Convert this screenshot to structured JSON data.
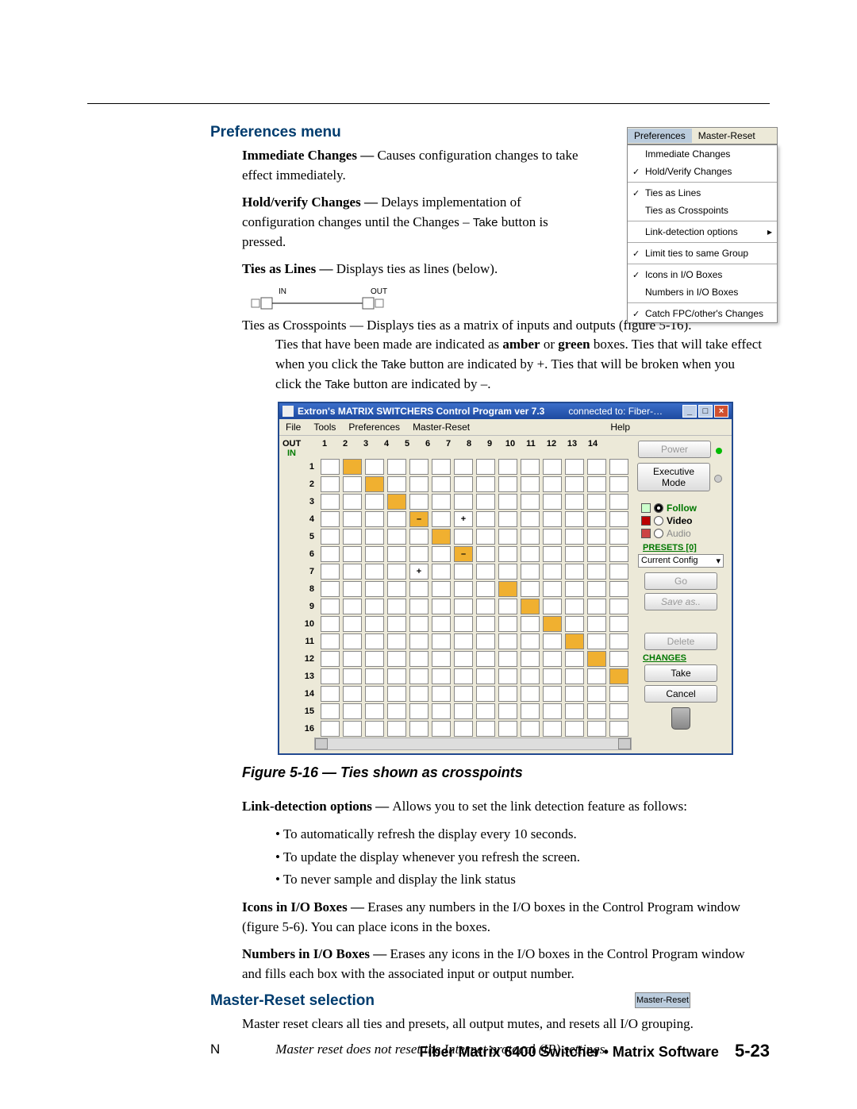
{
  "headings": {
    "prefs": "Preferences menu",
    "master": "Master-Reset selection"
  },
  "pref_menu": {
    "header": [
      "Preferences",
      "Master-Reset"
    ],
    "items": [
      "Immediate Changes",
      "Hold/Verify Changes",
      "Ties as Lines",
      "Ties as Crosspoints",
      "Link-detection options",
      "Limit ties to same Group",
      "Icons in I/O Boxes",
      "Numbers in I/O Boxes",
      "Catch FPC/other's Changes"
    ]
  },
  "io_diag": {
    "in": "IN",
    "out": "OUT"
  },
  "body": {
    "p1": {
      "b": "Immediate Changes — ",
      "t": "Causes configuration changes to take effect immediately."
    },
    "p2": {
      "b": "Hold/verify Changes — ",
      "t1": "Delays implementation of configuration changes until the Changes – ",
      "gui": "Take",
      "t2": " button is pressed."
    },
    "p3": {
      "b": "Ties as Lines — ",
      "t": "Displays ties as lines (below)."
    },
    "p4": {
      "t1": "Ties as Crosspoints — Displays ties as a matrix of inputs and outputs (figure 5-16).",
      "t2a": "Ties that have been made are indicated as ",
      "b1": "amber",
      "t2b": " or ",
      "b2": "green",
      "t2c": " boxes.  Ties that will take effect when you click the ",
      "gui1": "Take",
      "t3": " button are indicated by +.  Ties that will be broken when you click the ",
      "gui2": "Take",
      "t4": " button are indicated by –."
    },
    "p5": {
      "b": "Link-detection options — ",
      "t": "Allows you to set the link detection feature as follows:"
    },
    "bullets": [
      "To automatically refresh the display every 10 seconds.",
      "To update the display whenever you refresh the screen.",
      "To never sample and display the link status"
    ],
    "p6": {
      "b": "Icons in I/O Boxes — ",
      "t": "Erases any numbers in the I/O boxes in the Control Program window (figure 5-6).  You can place icons in the boxes."
    },
    "p7": {
      "b": "Numbers in I/O Boxes — ",
      "t": "Erases any icons in the I/O boxes in the Control Program window and fills each box with the associated input or output number."
    },
    "p8": "Master reset clears all ties and presets, all output mutes, and resets all I/O grouping."
  },
  "fig": {
    "title": "Extron's MATRIX SWITCHERS Control Program     ver 7.3",
    "connected": "connected to:  Fiber-…",
    "menus": [
      "File",
      "Tools",
      "Preferences",
      "Master-Reset",
      "Help"
    ],
    "out_label": "OUT",
    "in_label": "IN",
    "cols": [
      "1",
      "2",
      "3",
      "4",
      "5",
      "6",
      "7",
      "8",
      "9",
      "10",
      "11",
      "12",
      "13",
      "14"
    ],
    "rows": [
      "1",
      "2",
      "3",
      "4",
      "5",
      "6",
      "7",
      "8",
      "9",
      "10",
      "11",
      "12",
      "13",
      "14",
      "15",
      "16"
    ],
    "amber": [
      [
        1,
        2
      ],
      [
        2,
        3
      ],
      [
        3,
        4
      ],
      [
        4,
        5
      ],
      [
        5,
        6
      ],
      [
        6,
        7
      ],
      [
        8,
        9
      ],
      [
        9,
        10
      ],
      [
        10,
        11
      ],
      [
        11,
        12
      ],
      [
        12,
        13
      ],
      [
        13,
        14
      ]
    ],
    "marks": {
      "minus": [
        [
          4,
          5
        ],
        [
          6,
          7
        ]
      ],
      "plus": [
        [
          4,
          7
        ],
        [
          7,
          5
        ]
      ]
    },
    "side": {
      "power": "Power",
      "exec1": "Executive",
      "exec2": "Mode",
      "follow": "Follow",
      "video": "Video",
      "audio": "Audio",
      "presets": "PRESETS [0]",
      "preset_sel": "Current Config",
      "go": "Go",
      "saveas": "Save as..",
      "delete": "Delete",
      "changes": "CHANGES",
      "take": "Take",
      "cancel": "Cancel"
    },
    "caption": "Figure 5-16 — Ties shown as crosspoints"
  },
  "master_menu": "Master-Reset",
  "note": {
    "label": "N",
    "body": "Master reset does not reset the Internet protocol (IP) settings."
  },
  "footer": {
    "text": "Fiber Matrix 6400 Switcher • Matrix Software",
    "page": "5-23"
  }
}
